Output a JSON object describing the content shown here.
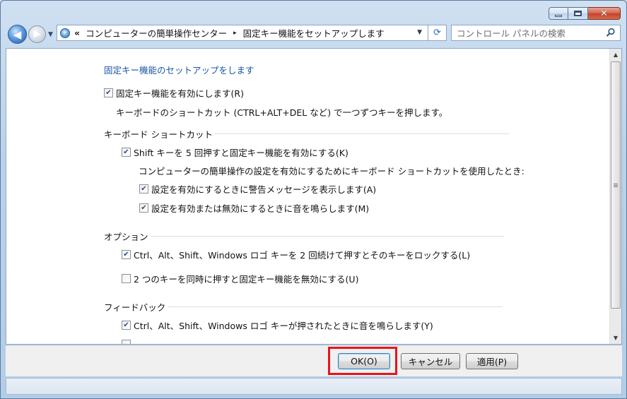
{
  "window": {
    "caption_buttons": [
      "minimize",
      "maximize",
      "close"
    ],
    "close_glyph": "✕"
  },
  "nav": {
    "back_icon": "back-arrow-icon",
    "forward_icon": "forward-arrow-icon",
    "back_glyph": "◀",
    "forward_glyph": "▶",
    "dropdown_glyph": "▼",
    "address": {
      "prefix": "«",
      "crumbs": [
        "コンピューターの簡単操作センター",
        "固定キー機能をセットアップします"
      ],
      "separator": "▸"
    },
    "refresh_glyph": "⟳",
    "search_placeholder": "コントロール パネルの検索"
  },
  "content": {
    "title": "固定キー機能のセットアップをします",
    "enable_sticky": {
      "label": "固定キー機能を有効にします(R)",
      "checked": true
    },
    "enable_sticky_desc": "キーボードのショートカット (CTRL+ALT+DEL など) で一つずつキーを押します。",
    "sections": {
      "keyboard_shortcut": {
        "heading": "キーボード ショートカット",
        "shift5": {
          "label": "Shift キーを 5 回押すと固定キー機能を有効にする(K)",
          "checked": true
        },
        "desc": "コンピューターの簡単操作の設定を有効にするためにキーボード ショートカットを使用したとき:",
        "warn": {
          "label": "設定を有効にするときに警告メッセージを表示します(A)",
          "checked": true
        },
        "sound": {
          "label": "設定を有効または無効にするときに音を鳴らします(M)",
          "checked": true
        }
      },
      "options": {
        "heading": "オプション",
        "lock": {
          "label": "Ctrl、Alt、Shift、Windows ロゴ キーを 2 回続けて押すとそのキーをロックする(L)",
          "checked": true
        },
        "disable2": {
          "label": "2 つのキーを同時に押すと固定キー機能を無効にする(U)",
          "checked": false
        }
      },
      "feedback": {
        "heading": "フィードバック",
        "beep": {
          "label": "Ctrl、Alt、Shift、Windows ロゴ キーが押されたときに音を鳴らします(Y)",
          "checked": true
        }
      }
    },
    "check_glyph": "✔"
  },
  "scrollbar": {
    "up_glyph": "▲",
    "down_glyph": "▼"
  },
  "buttons": {
    "ok": "OK(O)",
    "cancel": "キャンセル",
    "apply": "適用(P)"
  },
  "colors": {
    "link": "#1a55a8",
    "highlight": "#e8141c"
  }
}
